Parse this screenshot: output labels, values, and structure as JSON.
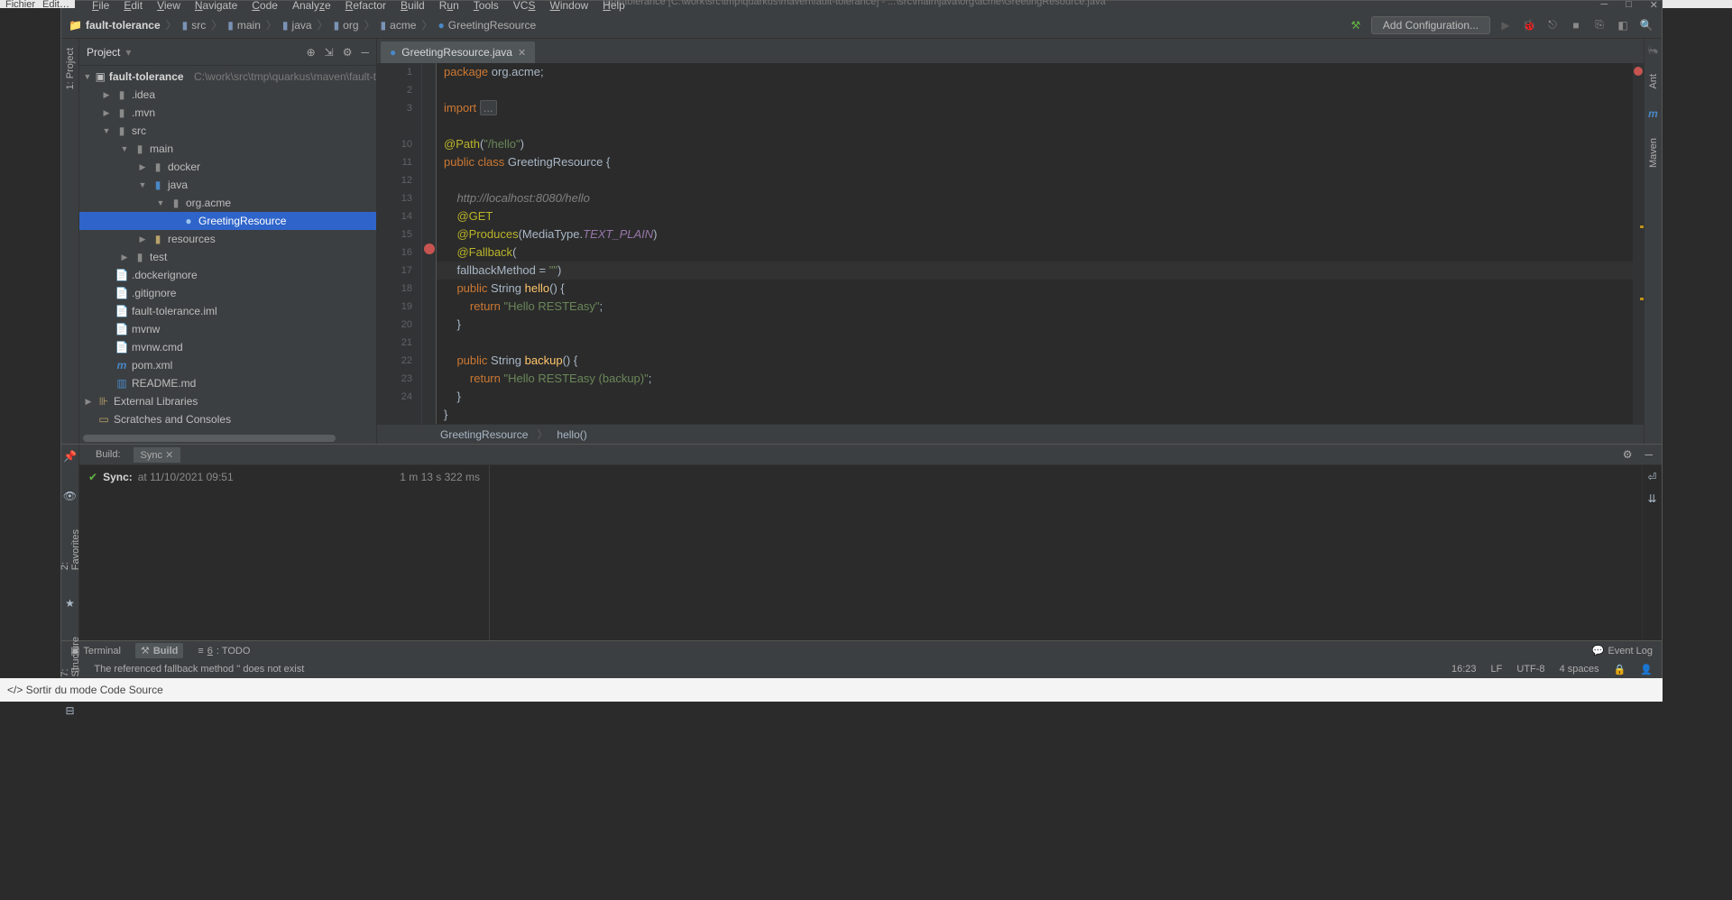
{
  "window": {
    "title": "fault-tolerance [C:\\work\\src\\tmp\\quarkus\\maven\\fault-tolerance] - ...\\src\\main\\java\\org\\acme\\GreetingResource.java"
  },
  "outer": {
    "left_btn1": "Fichier",
    "left_btn2": "Edit…",
    "exit_mode": "</> Sortir du mode Code Source"
  },
  "menu": {
    "file": "File",
    "edit": "Edit",
    "view": "View",
    "navigate": "Navigate",
    "code": "Code",
    "analyze": "Analyze",
    "refactor": "Refactor",
    "build": "Build",
    "run": "Run",
    "tools": "Tools",
    "vcs": "VCS",
    "window": "Window",
    "help": "Help"
  },
  "nav_right": {
    "config": "Add Configuration..."
  },
  "breadcrumbs": [
    "fault-tolerance",
    "src",
    "main",
    "java",
    "org",
    "acme",
    "GreetingResource"
  ],
  "project": {
    "header": "Project",
    "root": "fault-tolerance",
    "root_path": "C:\\work\\src\\tmp\\quarkus\\maven\\fault-t",
    "items": {
      "idea": ".idea",
      "mvn": ".mvn",
      "src": "src",
      "main": "main",
      "docker": "docker",
      "java": "java",
      "orgacme": "org.acme",
      "greeting": "GreetingResource",
      "resources": "resources",
      "test": "test",
      "dockerignore": ".dockerignore",
      "gitignore": ".gitignore",
      "iml": "fault-tolerance.iml",
      "mvnw": "mvnw",
      "mvnwcmd": "mvnw.cmd",
      "pom": "pom.xml",
      "readme": "README.md",
      "extlib": "External Libraries",
      "scratches": "Scratches and Consoles"
    }
  },
  "tabs": {
    "file1": "GreetingResource.java"
  },
  "right_gutter": {
    "ant": "Ant",
    "maven": "Maven"
  },
  "left_tools": {
    "project": "1: Project",
    "favorites": "2: Favorites",
    "structure": "7: Structure"
  },
  "code": {
    "pkg": "package",
    "pkg_name": "org.acme",
    "semi": ";",
    "import": "import",
    "fold": "...",
    "path_anno": "@Path",
    "path_val": "\"/hello\"",
    "public": "public",
    "class": "class",
    "cname": "GreetingResource",
    "brace": "{",
    "comment_url": "http://localhost:8080/hello",
    "get_anno": "@GET",
    "produces": "@Produces",
    "mediatype": "MediaType",
    "textplain": "TEXT_PLAIN",
    "fallback": "@Fallback",
    "fbmethod": "fallbackMethod",
    "eq": " = ",
    "empty": "\"\"",
    "string": "String",
    "hello": "hello",
    "parens_brace": "() {",
    "return": "return",
    "hello_str": "\"Hello RESTEasy\"",
    "backup": "backup",
    "backup_str": "\"Hello RESTEasy (backup)\"",
    "cbrace": "}"
  },
  "crumb": {
    "c1": "GreetingResource",
    "c2": "hello()"
  },
  "build": {
    "label": "Build:",
    "tab_sync": "Sync",
    "sync": "Sync:",
    "at": "at 11/10/2021 09:51",
    "duration": "1 m 13 s 322 ms"
  },
  "bottom": {
    "terminal": "Terminal",
    "build": "Build",
    "todo": "6: TODO",
    "eventlog": "Event Log"
  },
  "status": {
    "msg": "The referenced fallback method '' does not exist",
    "pos": "16:23",
    "le": "LF",
    "enc": "UTF-8",
    "indent": "4 spaces"
  }
}
